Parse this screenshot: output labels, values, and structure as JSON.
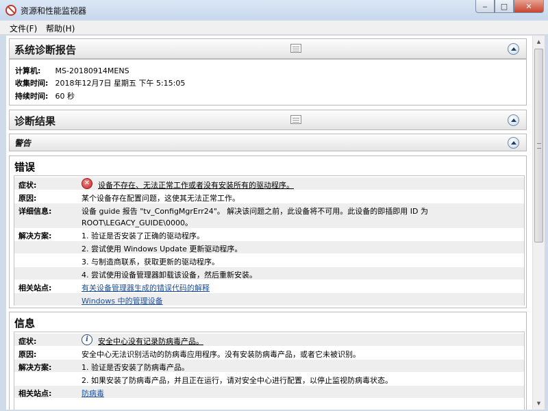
{
  "window": {
    "title": "资源和性能监视器",
    "controls": {
      "minimize": "‒",
      "maximize": "□",
      "close": "✕"
    }
  },
  "menu": {
    "items": [
      "文件(F)",
      "帮助(H)"
    ]
  },
  "report": {
    "title": "系统诊断报告",
    "fields": [
      {
        "label": "计算机:",
        "value": "MS-20180914MENS"
      },
      {
        "label": "收集时间:",
        "value": "2018年12月7日  星期五  下午  5:15:05"
      },
      {
        "label": "持续时间:",
        "value": "60 秒"
      }
    ]
  },
  "diagnostic": {
    "title": "诊断结果",
    "warning_bar": "警告"
  },
  "error": {
    "title": "错误",
    "symptom_label": "症状:",
    "symptom": "设备不存在、无法正常工作或者没有安装所有的驱动程序。",
    "cause_label": "原因:",
    "cause": "某个设备存在配置问题，这使其无法正常工作。",
    "detail_label": "详细信息:",
    "detail_line1": "设备  guide 报告 \"tv_ConfigMgrErr24\"。  解决该问题之前，此设备将不可用。此设备的即插即用  ID 为",
    "detail_line2": "ROOT\\LEGACY_GUIDE\\0000。",
    "solution_label": "解决方案:",
    "solutions": [
      "1. 验证是否安装了正确的驱动程序。",
      "2. 尝试使用  Windows Update 更新驱动程序。",
      "3. 与制造商联系，获取更新的驱动程序。",
      "4. 尝试使用设备管理器卸载该设备，然后重新安装。"
    ],
    "sites_label": "相关站点:",
    "sites": [
      "有关设备管理器生成的错误代码的解释",
      "Windows 中的管理设备"
    ]
  },
  "info": {
    "title": "信息",
    "symptom_label": "症状:",
    "symptom": "安全中心没有记录防病毒产品。",
    "cause_label": "原因:",
    "cause": "安全中心无法识别活动的防病毒应用程序。没有安装防病毒产品，或者它未被识别。",
    "solution_label": "解决方案:",
    "solutions": [
      "1. 验证是否安装了防病毒产品。",
      "2. 如果安装了防病毒产品，并且正在运行，请对安全中心进行配置，以停止监视防病毒状态。"
    ],
    "sites_label": "相关站点:",
    "sites": [
      "防病毒"
    ]
  },
  "icons": {
    "app": "resource-monitor-icon",
    "report": "report-view-icon",
    "collapse": "collapse-up-icon",
    "error": "error-icon",
    "info": "info-icon",
    "error_glyph": "✕",
    "info_glyph": "i"
  },
  "colors": {
    "link": "#1a4f9c",
    "error": "#c82424",
    "info": "#2b4c7e"
  }
}
